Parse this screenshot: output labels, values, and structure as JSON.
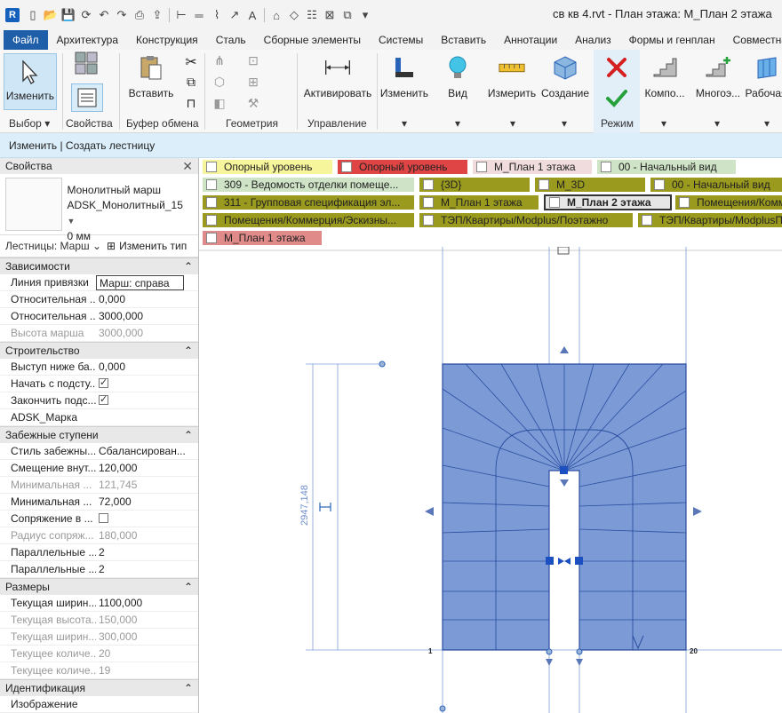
{
  "window": {
    "title": "св кв 4.rvt - План этажа: М_План 2 этажа",
    "logo": "R"
  },
  "tabs": [
    "Файл",
    "Архитектура",
    "Конструкция",
    "Сталь",
    "Сборные элементы",
    "Системы",
    "Вставить",
    "Аннотации",
    "Анализ",
    "Формы и генплан",
    "Совместная"
  ],
  "ribbon": {
    "modify": "Изменить",
    "insert": "Вставить",
    "activate": "Активировать",
    "modify2": "Изменить",
    "view": "Вид",
    "measure": "Измерить",
    "create": "Создание",
    "component": "Компо...",
    "multi": "Многоэ...",
    "work": "Рабочая",
    "panels": {
      "select": "Выбор",
      "props": "Свойства",
      "clipboard": "Буфер обмена",
      "geometry": "Геометрия",
      "control": "Управление",
      "mode": "Режим"
    }
  },
  "context_bar": "Изменить | Создать лестницу",
  "properties": {
    "header": "Свойства",
    "type_name_1": "Монолитный марш",
    "type_name_2": "ADSK_Монолитный_15",
    "type_name_3": "0 мм",
    "instance_selector": "Лестницы: Марш",
    "edit_type": "Изменить тип",
    "groups": {
      "constraints": "Зависимости",
      "construction": "Строительство",
      "winders": "Забежные ступени",
      "dimensions": "Размеры",
      "identity": "Идентификация"
    },
    "rows": {
      "r1": {
        "k": "Линия привязки",
        "v": "Марш: справа"
      },
      "r2": {
        "k": "Относительная ...",
        "v": "0,000"
      },
      "r3": {
        "k": "Относительная ...",
        "v": "3000,000"
      },
      "r4": {
        "k": "Высота марша",
        "v": "3000,000"
      },
      "r5": {
        "k": "Выступ ниже ба...",
        "v": "0,000"
      },
      "r6": {
        "k": "Начать с подсту..."
      },
      "r7": {
        "k": "Закончить подс..."
      },
      "r8": {
        "k": "ADSK_Марка"
      },
      "r9": {
        "k": "Стиль забежны...",
        "v": "Сбалансирован..."
      },
      "r10": {
        "k": "Смещение внут...",
        "v": "120,000"
      },
      "r11": {
        "k": "Минимальная ...",
        "v": "121,745"
      },
      "r12": {
        "k": "Минимальная ...",
        "v": "72,000"
      },
      "r13": {
        "k": "Сопряжение в ..."
      },
      "r14": {
        "k": "Радиус сопряж...",
        "v": "180,000"
      },
      "r15": {
        "k": "Параллельные ...",
        "v": "2"
      },
      "r16": {
        "k": "Параллельные ...",
        "v": "2"
      },
      "r17": {
        "k": "Текущая ширин...",
        "v": "1100,000"
      },
      "r18": {
        "k": "Текущая высота...",
        "v": "150,000"
      },
      "r19": {
        "k": "Текущая ширин...",
        "v": "300,000"
      },
      "r20": {
        "k": "Текущее количе...",
        "v": "20"
      },
      "r21": {
        "k": "Текущее количе...",
        "v": "19"
      },
      "r22": {
        "k": "Изображение"
      }
    }
  },
  "view_tabs": {
    "t1": "Опорный уровень",
    "t2": "Опорный уровень",
    "t3": "М_План 1 этажа",
    "t4": "00 - Начальный вид",
    "t5": "309 - Ведомость отделки помеще...",
    "t6": "{3D}",
    "t7": "М_3D",
    "t8": "00 - Начальный вид",
    "t9": "311 - Групповая спецификация эл...",
    "t10": "М_План 1 этажа",
    "t11": "М_План 2 этажа",
    "t12": "Помещения/Комм",
    "t13": "Помещения/Коммерция/Эскизны...",
    "t14": "ТЭП/Квартиры/Modplus/Поэтажно",
    "t15": "ТЭП/Квартиры/ModplusП",
    "t16": "М_План 1 этажа"
  },
  "drawing": {
    "dimension": "2947,148",
    "label_1": "1",
    "label_20": "20"
  }
}
